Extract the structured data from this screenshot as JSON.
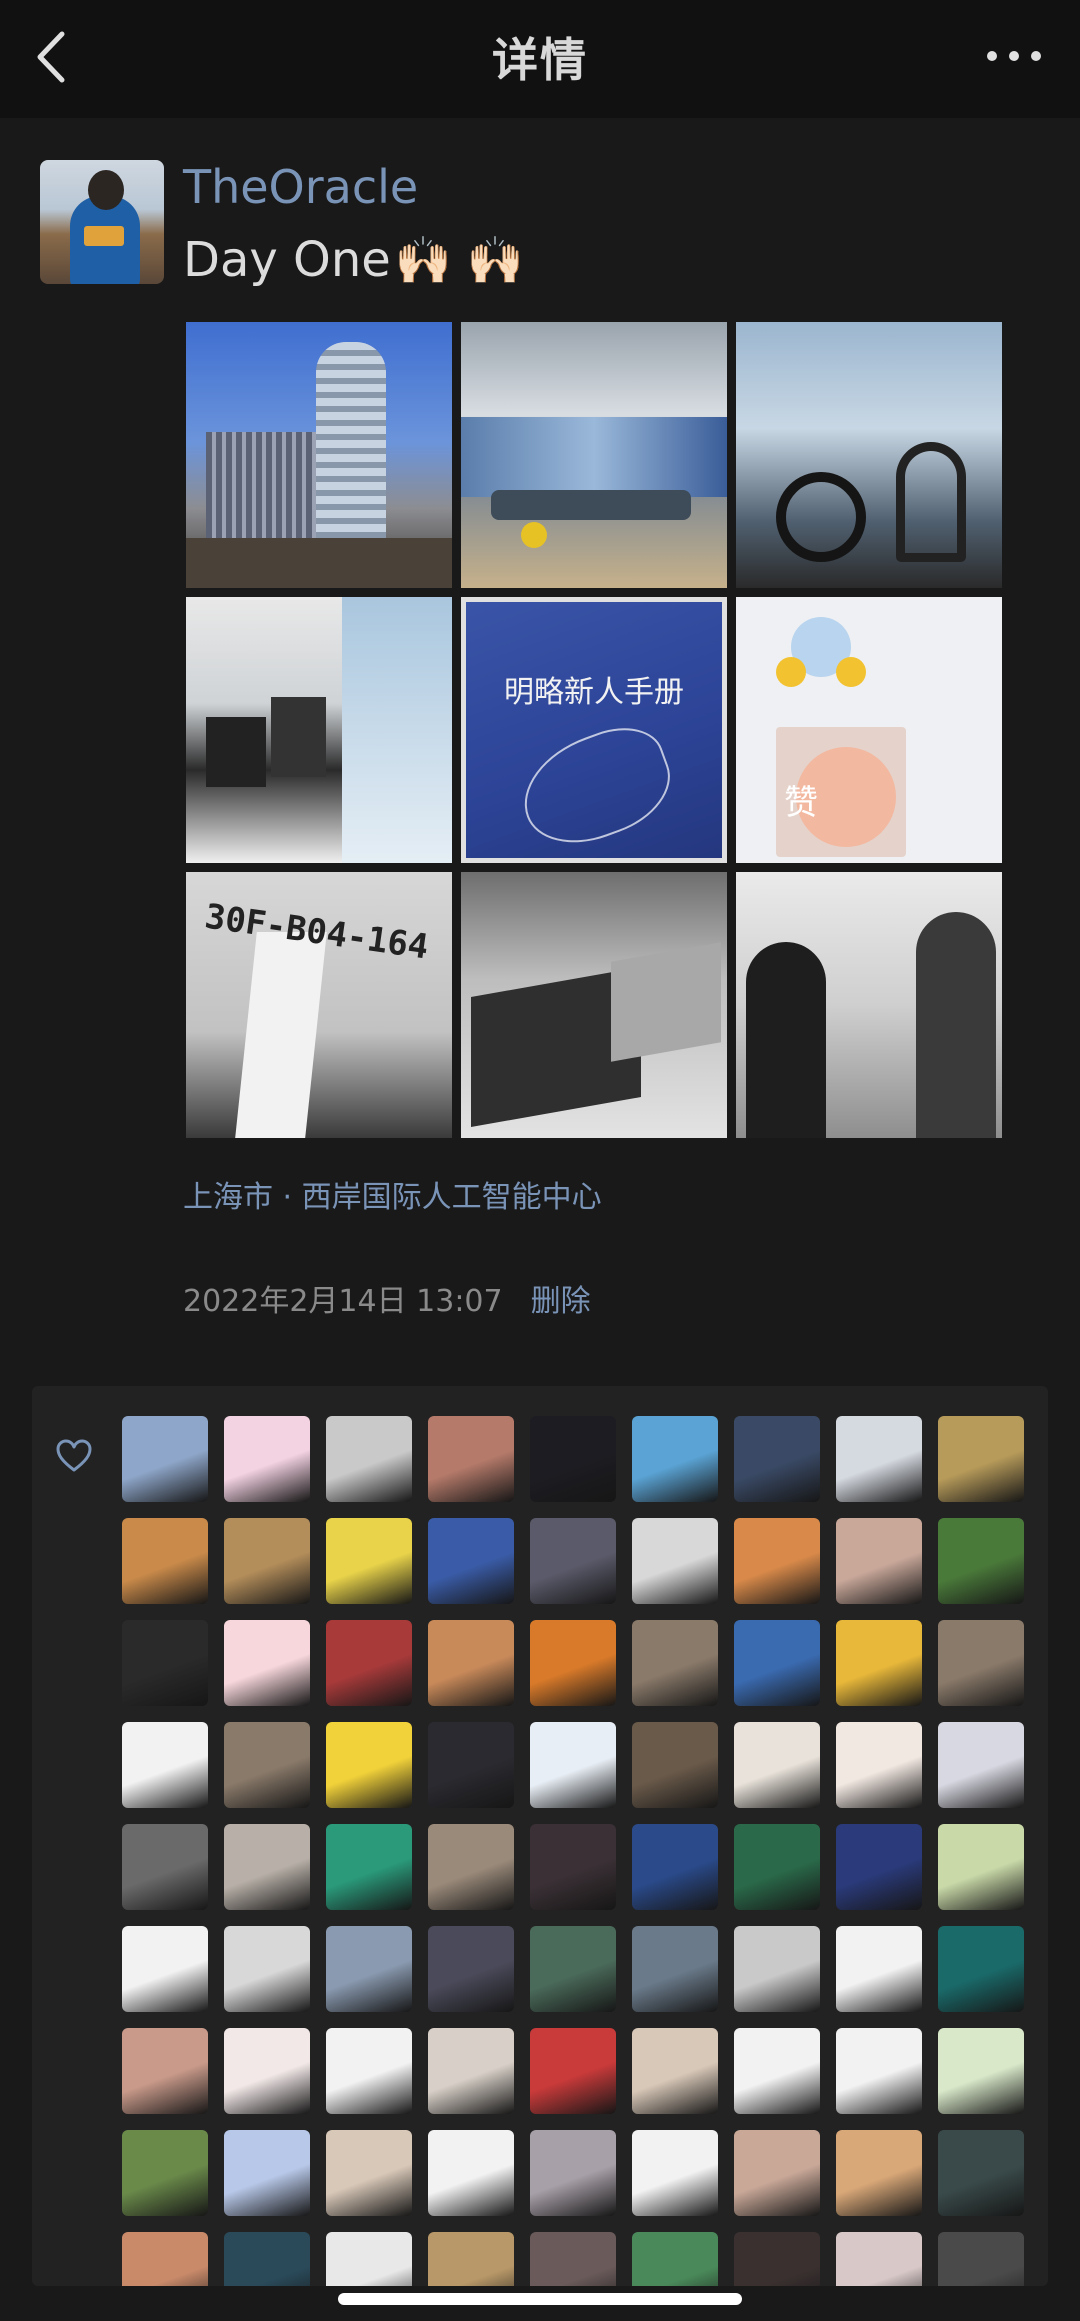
{
  "nav": {
    "title": "详情",
    "back_icon": "chevron-left-icon",
    "more_icon": "more-dots-icon"
  },
  "post": {
    "username": "TheOracle",
    "text": "Day One",
    "emoji": "🙌🏻 🙌🏻",
    "photos": [
      {
        "name": "building"
      },
      {
        "name": "office-lounge"
      },
      {
        "name": "gym-bikes"
      },
      {
        "name": "pantry"
      },
      {
        "name": "handbook",
        "caption": "明略新人手册"
      },
      {
        "name": "chat-screenshot",
        "caption": "赞"
      },
      {
        "name": "desk-label",
        "caption": "30F-B04-164"
      },
      {
        "name": "laptops"
      },
      {
        "name": "people-walking"
      }
    ],
    "location": "上海市 · 西岸国际人工智能中心",
    "timestamp": "2022年2月14日 13:07",
    "delete_label": "删除"
  },
  "likes": {
    "icon": "heart-icon",
    "avatars": [
      "#8ea6c9",
      "#f3d2e2",
      "#c9c9c9",
      "#b57a6a",
      "#1c1c22",
      "#5aa3d4",
      "#3a4a66",
      "#d5d9e0",
      "#b79b5a",
      "#c98a4a",
      "#b38d5a",
      "#e8d34a",
      "#3a5ca8",
      "#5a5a6a",
      "#d8d8d8",
      "#d98a4a",
      "#c9a89a",
      "#4a7a3a",
      "#2a2a2a",
      "#f7d7dc",
      "#a83a3a",
      "#c98a5a",
      "#d97a2a",
      "#8a7a6a",
      "#3a6ab0",
      "#e8b83a",
      "#8a7a6a",
      "#f2f2f2",
      "#8a7a6a",
      "#f2d23a",
      "#2a2a30",
      "#e8eef5",
      "#6a5a4a",
      "#e8e2da",
      "#f2e8e2",
      "#d8d8e2",
      "#6a6a6a",
      "#b8b0a8",
      "#2a9a7a",
      "#9a8a7a",
      "#3a3035",
      "#2a4a8a",
      "#2a6a4a",
      "#2a3a7a",
      "#c9d9a8",
      "#f2f2f2",
      "#d8d8d8",
      "#8a9ab0",
      "#4a4a5a",
      "#4a6a5a",
      "#6a7a8a",
      "#c9c9c9",
      "#f2f2f2",
      "#1a6a6a",
      "#c99a8a",
      "#f2e8e8",
      "#f2f2f2",
      "#d8d0c8",
      "#c93a3a",
      "#d8c8b8",
      "#f2f2f2",
      "#f2f2f2",
      "#d8e8c9",
      "#6a8a4a",
      "#b8c8e8",
      "#d8c8b8",
      "#f2f2f2",
      "#a8a0a8",
      "#f2f2f2",
      "#c9a898",
      "#d9a878",
      "#3a4a4a",
      "#c98a6a",
      "#2a4a5a",
      "#e8e8e8",
      "#b89868",
      "#6a5a5a",
      "#4a8a5a",
      "#3a3030",
      "#d8c8c8",
      "#4a4a4a"
    ]
  }
}
